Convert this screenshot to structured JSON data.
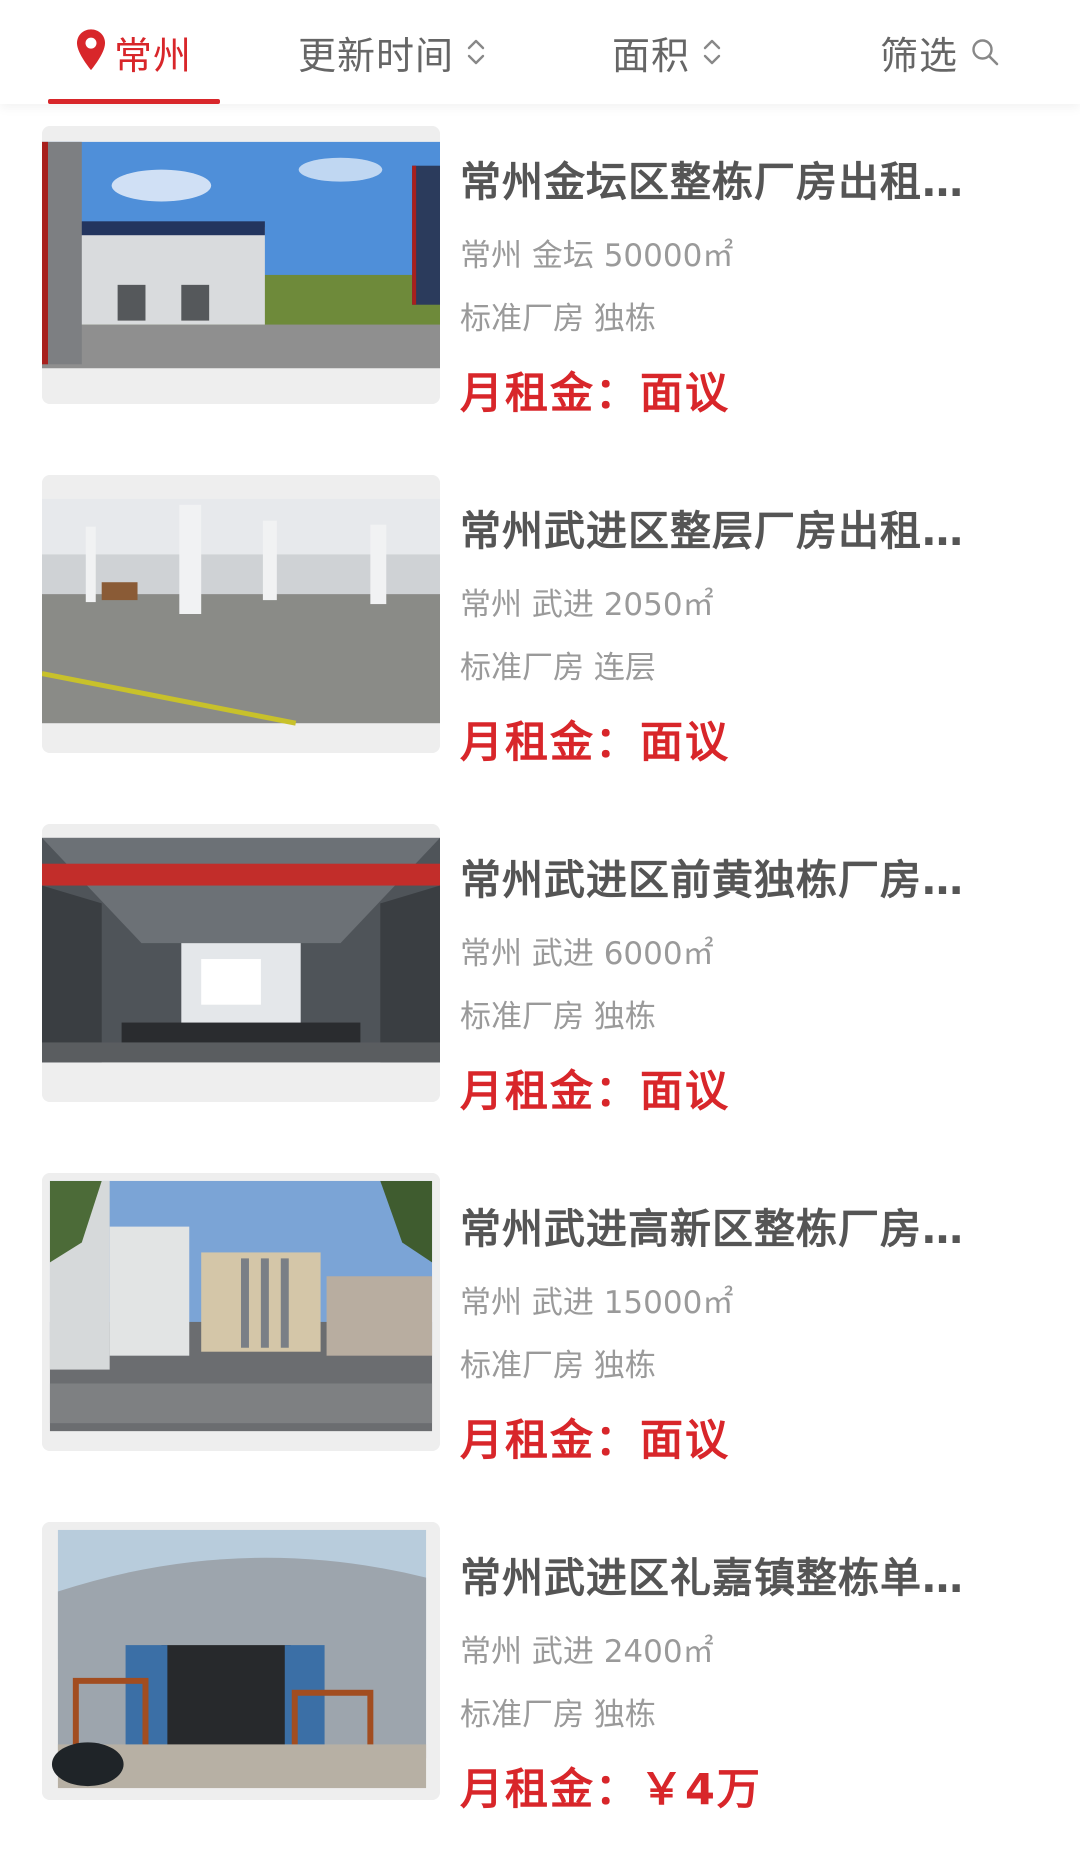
{
  "filter_bar": {
    "city": "常州",
    "sort_time": "更新时间",
    "sort_area": "面积",
    "filter": "筛选"
  },
  "colors": {
    "accent": "#d8262a",
    "title": "#555555",
    "meta": "#9a9a9a"
  },
  "icons": {
    "city": "location-pin-icon",
    "sort": "up-down-chevron-icon",
    "filter": "search-icon"
  },
  "listings": [
    {
      "title": "常州金坛区整栋厂房出租…",
      "meta": "常州 金坛 50000㎡",
      "tags": "标准厂房 独栋",
      "price": "月租金：面议"
    },
    {
      "title": "常州武进区整层厂房出租…",
      "meta": "常州 武进 2050㎡",
      "tags": "标准厂房 连层",
      "price": "月租金：面议"
    },
    {
      "title": "常州武进区前黄独栋厂房…",
      "meta": "常州 武进 6000㎡",
      "tags": "标准厂房 独栋",
      "price": "月租金：面议"
    },
    {
      "title": "常州武进高新区整栋厂房…",
      "meta": "常州 武进 15000㎡",
      "tags": "标准厂房 独栋",
      "price": "月租金：面议"
    },
    {
      "title": "常州武进区礼嘉镇整栋单…",
      "meta": "常州 武进 2400㎡",
      "tags": "标准厂房 独栋",
      "price": "月租金：￥4万"
    }
  ]
}
